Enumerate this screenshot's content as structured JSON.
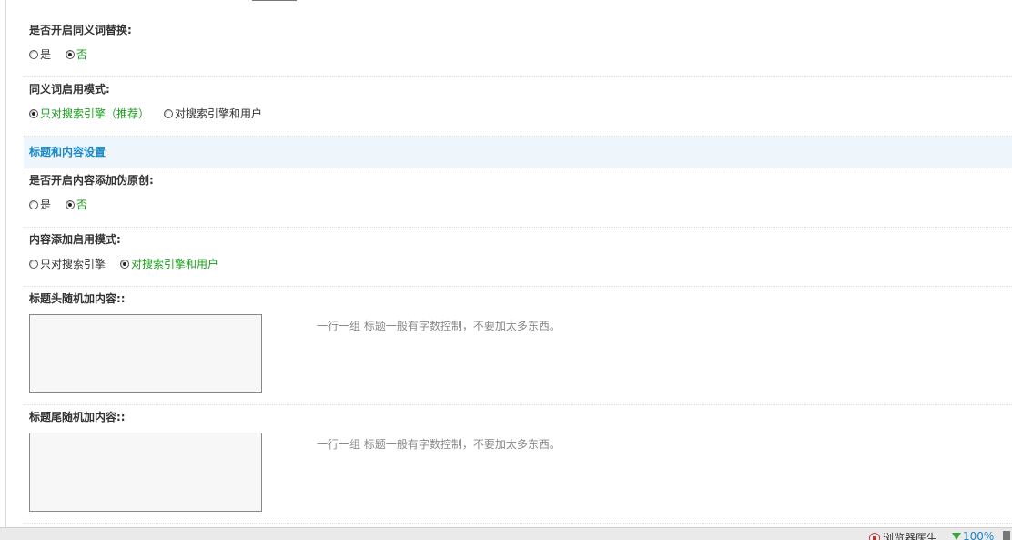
{
  "settings": {
    "synonym_enable": {
      "label": "是否开启同义词替换:",
      "options": [
        "是",
        "否"
      ],
      "selected": "否"
    },
    "synonym_mode": {
      "label": "同义词启用模式:",
      "options": [
        "只对搜索引擎（推荐）",
        "对搜索引擎和用户"
      ],
      "selected": "只对搜索引擎（推荐）"
    },
    "section_title": "标题和内容设置",
    "pseudo_original": {
      "label": "是否开启内容添加伪原创:",
      "options": [
        "是",
        "否"
      ],
      "selected": "否"
    },
    "content_mode": {
      "label": "内容添加启用模式:",
      "options": [
        "只对搜索引擎",
        "对搜索引擎和用户"
      ],
      "selected": "对搜索引擎和用户"
    },
    "title_head": {
      "label": "标题头随机加内容::",
      "value": "",
      "hint": "一行一组 标题一般有字数控制，不要加太多东西。"
    },
    "title_tail": {
      "label": "标题尾随机加内容::",
      "value": "",
      "hint": "一行一组 标题一般有字数控制，不要加太多东西。"
    }
  },
  "statusbar": {
    "doctor": "浏览器医生",
    "zoom": "100%"
  }
}
